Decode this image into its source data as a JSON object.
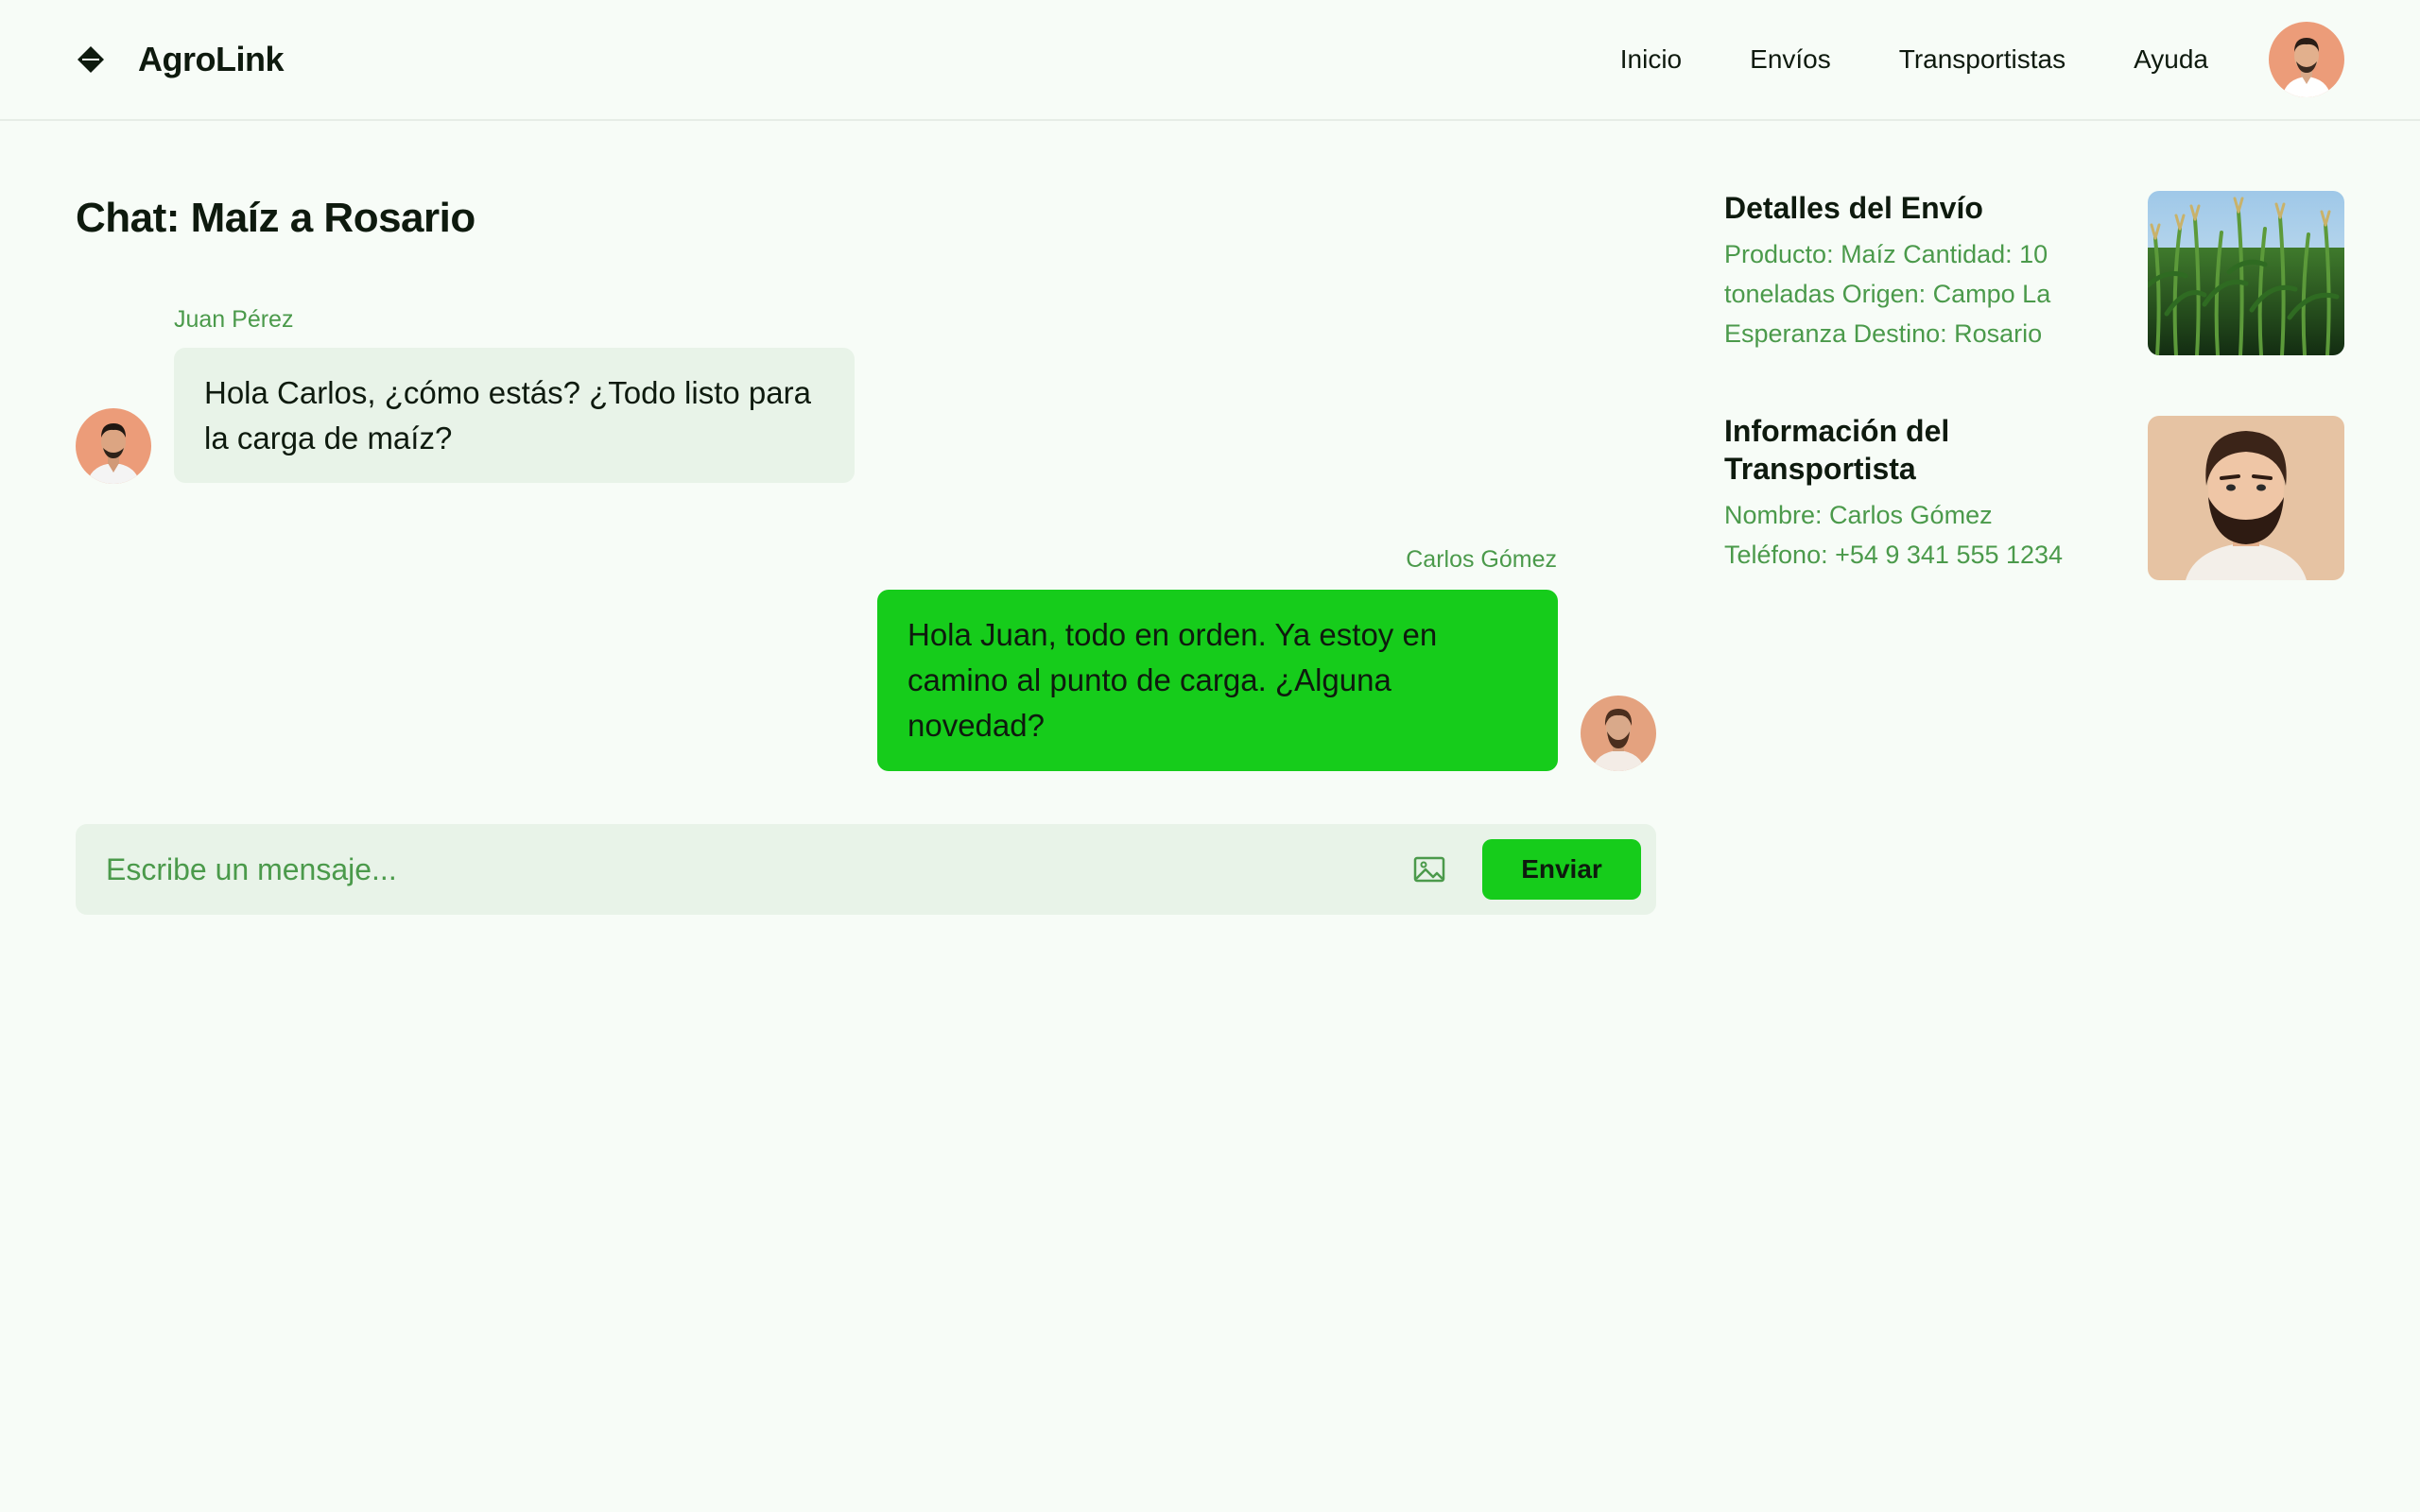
{
  "header": {
    "brand_name": "AgroLink",
    "brand_icon": "diamond-logo-icon",
    "nav": [
      {
        "label": "Inicio"
      },
      {
        "label": "Envíos"
      },
      {
        "label": "Transportistas"
      },
      {
        "label": "Ayuda"
      }
    ],
    "user_avatar": "user-avatar"
  },
  "chat": {
    "title": "Chat: Maíz a Rosario",
    "messages": [
      {
        "sender": "Juan Pérez",
        "text": "Hola Carlos, ¿cómo estás? ¿Todo listo para la carga de maíz?",
        "direction": "incoming"
      },
      {
        "sender": "Carlos Gómez",
        "text": "Hola Juan, todo en orden. Ya estoy en camino al punto de carga. ¿Alguna novedad?",
        "direction": "outgoing"
      }
    ],
    "composer": {
      "placeholder": "Escribe un mensaje...",
      "attach_icon": "image-icon",
      "send_label": "Enviar"
    }
  },
  "side": {
    "shipment": {
      "title": "Detalles del Envío",
      "body": "Producto: Maíz Cantidad: 10 toneladas Origen: Campo La Esperanza Destino: Rosario",
      "image": "corn-field-photo"
    },
    "carrier": {
      "title": "Información del Transportista",
      "body": "Nombre: Carlos Gómez Teléfono: +54 9 341 555 1234",
      "image": "carrier-portrait"
    }
  },
  "colors": {
    "background": "#f7fcf7",
    "accent_green": "#16cc1b",
    "muted_green": "#4b9a4b",
    "bubble_light": "#e8f3e8",
    "text_dark": "#0e1a0e"
  }
}
